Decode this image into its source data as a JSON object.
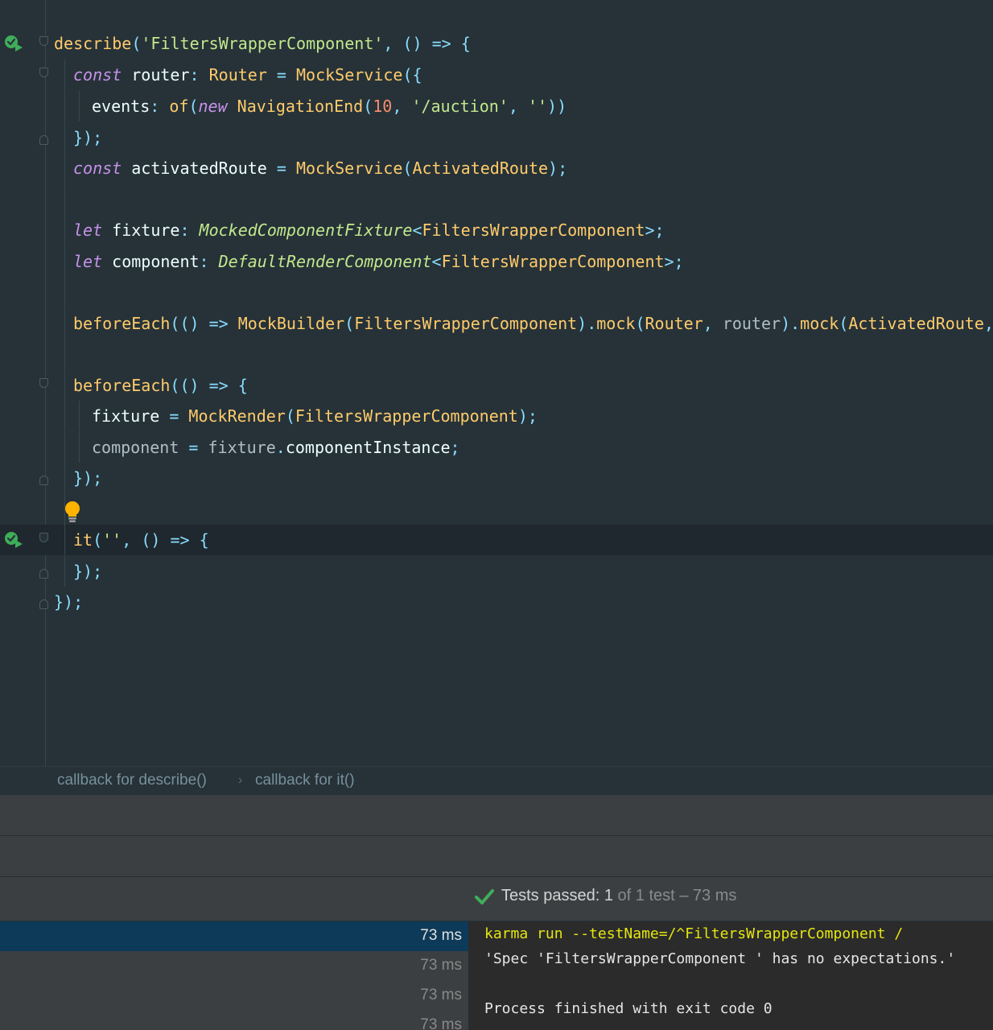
{
  "editor": {
    "lines": [
      [
        [
          "describe",
          "fn"
        ],
        [
          "(",
          "op"
        ],
        [
          "'FiltersWrapperComponent'",
          "str"
        ],
        [
          ", () => {",
          "op"
        ]
      ],
      [
        [
          "const",
          "kw"
        ],
        [
          " router",
          "id"
        ],
        [
          ": ",
          "op"
        ],
        [
          "Router",
          "type"
        ],
        [
          " = ",
          "op"
        ],
        [
          "MockService",
          "fn"
        ],
        [
          "({",
          "op"
        ]
      ],
      [
        [
          "events",
          "prop"
        ],
        [
          ": ",
          "op"
        ],
        [
          "of",
          "fn"
        ],
        [
          "(",
          "op"
        ],
        [
          "new",
          "kw"
        ],
        [
          " ",
          "id"
        ],
        [
          "NavigationEnd",
          "type"
        ],
        [
          "(",
          "op"
        ],
        [
          "10",
          "num"
        ],
        [
          ", ",
          "op"
        ],
        [
          "'/auction'",
          "str"
        ],
        [
          ", ",
          "op"
        ],
        [
          "''",
          "str"
        ],
        [
          "))",
          "op"
        ]
      ],
      [
        [
          "});",
          "op"
        ]
      ],
      [
        [
          "const",
          "kw"
        ],
        [
          " activatedRoute",
          "id"
        ],
        [
          " = ",
          "op"
        ],
        [
          "MockService",
          "fn"
        ],
        [
          "(",
          "op"
        ],
        [
          "ActivatedRoute",
          "type"
        ],
        [
          ");",
          "op"
        ]
      ],
      [],
      [
        [
          "let",
          "kw"
        ],
        [
          " fixture",
          "id"
        ],
        [
          ": ",
          "op"
        ],
        [
          "MockedComponentFixture",
          "itype"
        ],
        [
          "<",
          "op"
        ],
        [
          "FiltersWrapperComponent",
          "type"
        ],
        [
          ">;",
          "op"
        ]
      ],
      [
        [
          "let",
          "kw"
        ],
        [
          " component",
          "id"
        ],
        [
          ": ",
          "op"
        ],
        [
          "DefaultRenderComponent",
          "itype"
        ],
        [
          "<",
          "op"
        ],
        [
          "FiltersWrapperComponent",
          "type"
        ],
        [
          ">;",
          "op"
        ]
      ],
      [],
      [
        [
          "beforeEach",
          "fn"
        ],
        [
          "(() => ",
          "op"
        ],
        [
          "MockBuilder",
          "fn"
        ],
        [
          "(",
          "op"
        ],
        [
          "FiltersWrapperComponent",
          "type"
        ],
        [
          ").",
          "op"
        ],
        [
          "mock",
          "fn"
        ],
        [
          "(",
          "op"
        ],
        [
          "Router",
          "type"
        ],
        [
          ", ",
          "op"
        ],
        [
          "router",
          "muted"
        ],
        [
          ").",
          "op"
        ],
        [
          "mock",
          "fn"
        ],
        [
          "(",
          "op"
        ],
        [
          "ActivatedRoute",
          "type"
        ],
        [
          ", a",
          "op"
        ]
      ],
      [],
      [
        [
          "beforeEach",
          "fn"
        ],
        [
          "(() => {",
          "op"
        ]
      ],
      [
        [
          "fixture",
          "prop"
        ],
        [
          " = ",
          "op"
        ],
        [
          "MockRender",
          "fn"
        ],
        [
          "(",
          "op"
        ],
        [
          "FiltersWrapperComponent",
          "type"
        ],
        [
          ");",
          "op"
        ]
      ],
      [
        [
          "component",
          "muted"
        ],
        [
          " = ",
          "op"
        ],
        [
          "fixture",
          "muted"
        ],
        [
          ".",
          "op"
        ],
        [
          "componentInstance",
          "prop"
        ],
        [
          ";",
          "op"
        ]
      ],
      [
        [
          "});",
          "op"
        ]
      ],
      [],
      [
        [
          "it",
          "fn"
        ],
        [
          "(",
          "op"
        ],
        [
          "''",
          "str"
        ],
        [
          ", () => {",
          "op"
        ]
      ],
      [
        [
          "});",
          "op"
        ]
      ],
      [
        [
          "});",
          "op"
        ]
      ]
    ]
  },
  "breadcrumbs": [
    "callback for describe()",
    "callback for it()"
  ],
  "test_status": {
    "passed_label": "Tests passed:",
    "passed_count": "1",
    "rest": "of 1 test – 73 ms"
  },
  "test_tree": [
    "73 ms",
    "73 ms",
    "73 ms",
    "73 ms"
  ],
  "console": [
    "karma run --testName=/^FiltersWrapperComponent /",
    "'Spec 'FiltersWrapperComponent ' has no expectations.'",
    "",
    "Process finished with exit code 0"
  ],
  "colors": {
    "editor_bg": "#263238",
    "function": "#ffcb6b",
    "string": "#c3e88d",
    "keyword": "#c792ea",
    "operator": "#89ddff",
    "number": "#f78c6c",
    "pass_green": "#3fae5a",
    "console_command": "#e5e510"
  }
}
